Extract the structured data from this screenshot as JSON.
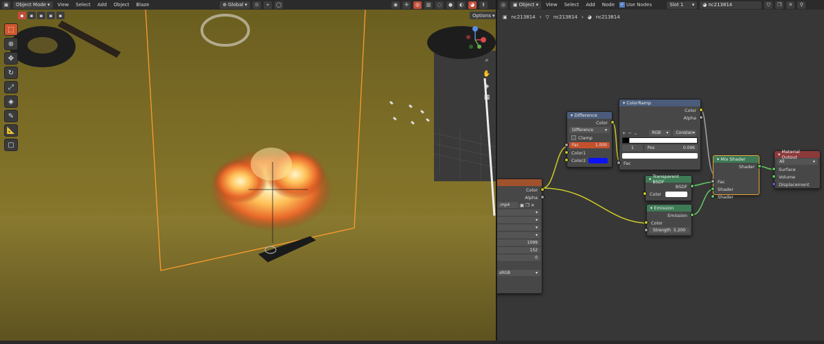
{
  "viewport_header": {
    "mode": "Object Mode",
    "menus": [
      "View",
      "Select",
      "Add",
      "Object",
      "Blaze"
    ],
    "orientation": "Global",
    "options_label": "Options"
  },
  "node_header": {
    "type": "Object",
    "menus": [
      "View",
      "Select",
      "Add",
      "Node"
    ],
    "use_nodes_label": "Use Nodes",
    "slot": "Slot 1",
    "material": "nc213814"
  },
  "breadcrumb": [
    "nc213814",
    "nc213814",
    "nc213814"
  ],
  "nodes": {
    "image": {
      "filename": ".mp4",
      "out_color": "Color",
      "out_alpha": "Alpha",
      "frames": "1099",
      "start": "152",
      "offset": "0",
      "colorspace": "sRGB"
    },
    "difference": {
      "title": "Difference",
      "out_color": "Color",
      "blend": "Difference",
      "clamp": "Clamp",
      "fac_label": "Fac",
      "fac_value": "1.000",
      "color1": "Color1",
      "color2": "Color2",
      "color2_hex": "#0b13f5"
    },
    "colorramp": {
      "title": "ColorRamp",
      "out_color": "Color",
      "out_alpha": "Alpha",
      "mode": "RGB",
      "interp": "Constan",
      "index": "1",
      "pos_label": "Pos",
      "pos_value": "0.096",
      "in_fac": "Fac"
    },
    "transparent": {
      "title": "Transparent BSDF",
      "out": "BSDF",
      "color": "Color"
    },
    "emission": {
      "title": "Emission",
      "out": "Emission",
      "color": "Color",
      "strength_label": "Strength",
      "strength_value": "5.200"
    },
    "mix": {
      "title": "Mix Shader",
      "out": "Shader",
      "fac": "Fac",
      "shader1": "Shader",
      "shader2": "Shader"
    },
    "output": {
      "title": "Material Output",
      "target": "All",
      "surface": "Surface",
      "volume": "Volume",
      "displacement": "Displacement"
    }
  },
  "colors": {
    "accent_orange": "#d1572f",
    "select_orange": "#e8a53a",
    "shader_green": "#63c763",
    "color_yellow": "#c7c729"
  }
}
